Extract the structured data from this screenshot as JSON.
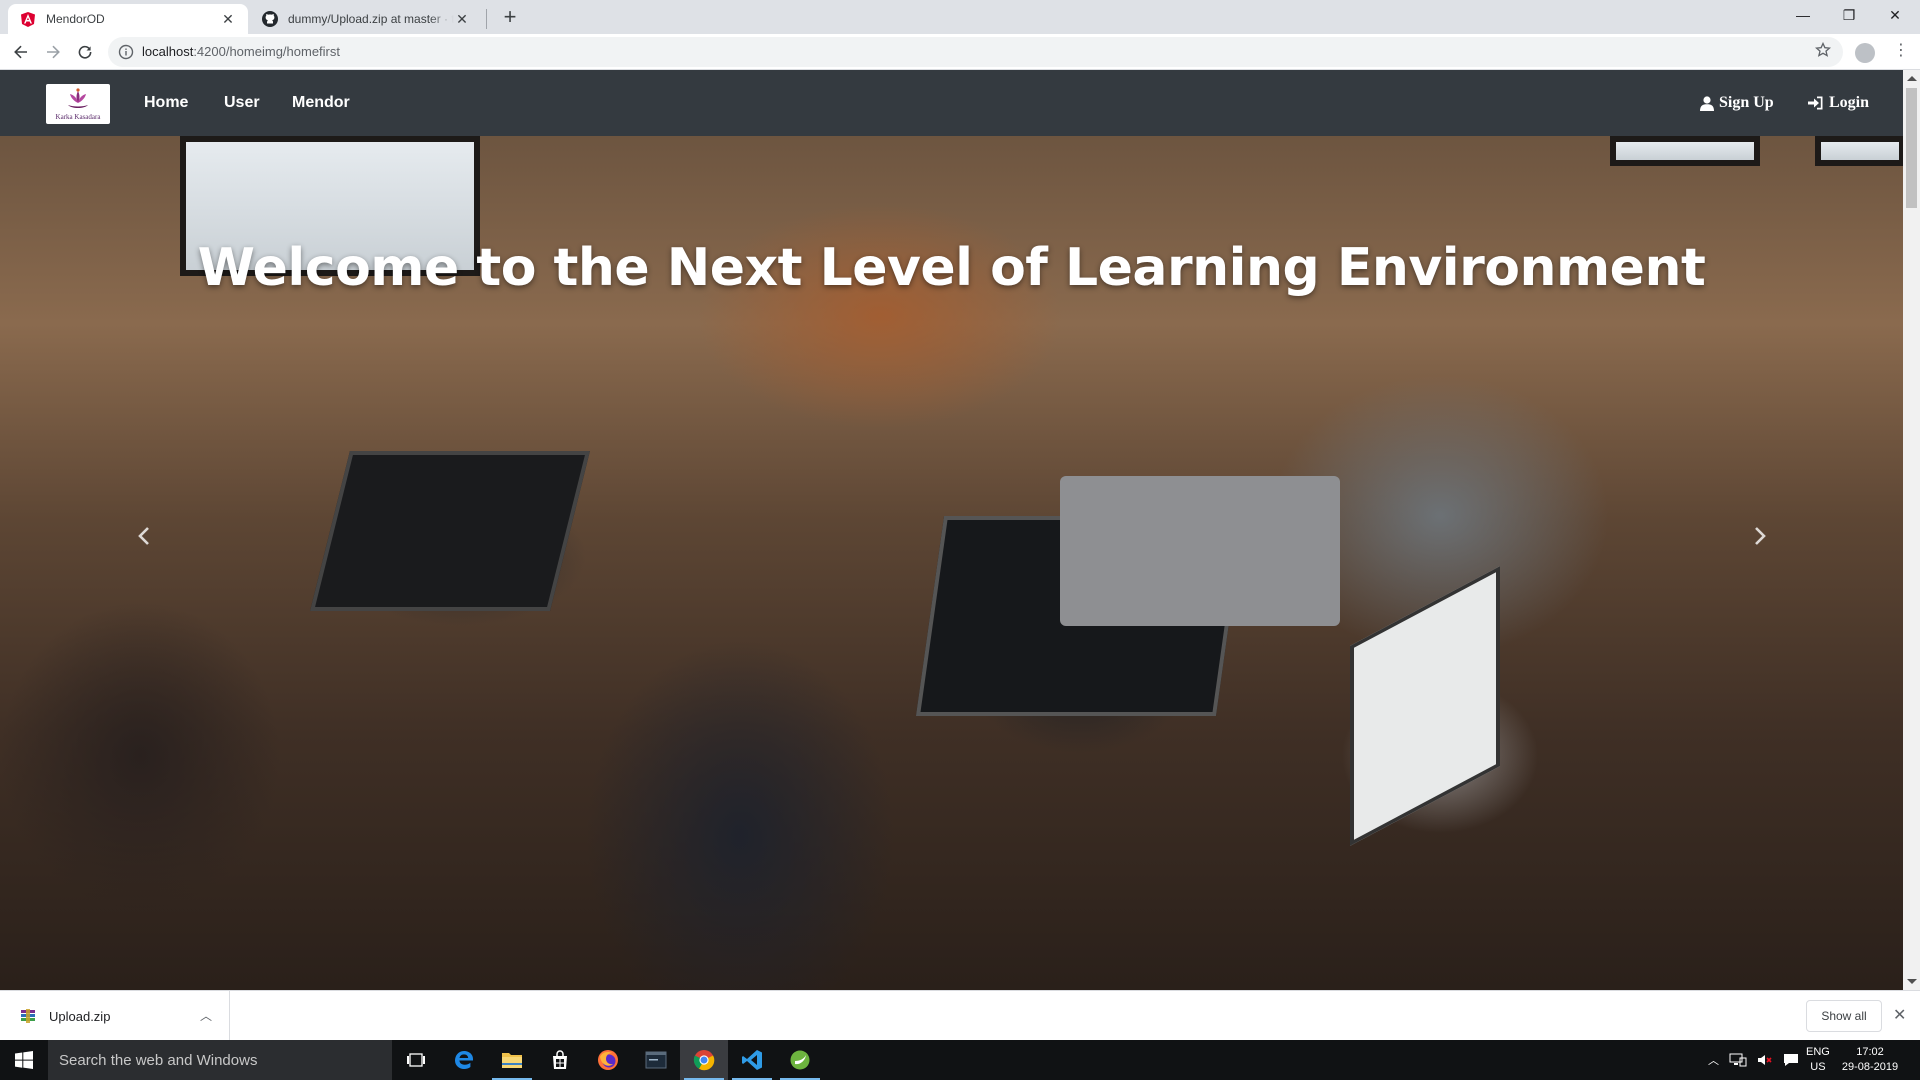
{
  "browser": {
    "tabs": [
      {
        "title": "MendorOD",
        "favicon": "angular-icon"
      },
      {
        "title": "dummy/Upload.zip at master · th",
        "favicon": "github-icon"
      }
    ],
    "new_tab": "+",
    "address": {
      "host": "localhost",
      "path": ":4200/homeimg/homefirst"
    },
    "window_controls": {
      "minimize": "—",
      "maximize": "❐",
      "close": "✕"
    }
  },
  "app": {
    "brand_text": "Karka Kasadara",
    "nav": {
      "home": "Home",
      "user": "User",
      "mendor": "Mendor"
    },
    "auth": {
      "signup": "Sign Up",
      "login": "Login"
    },
    "hero": {
      "headline": "Welcome to the Next Level of Learning Environment"
    }
  },
  "downloads": {
    "file_name": "Upload.zip",
    "show_all": "Show all"
  },
  "taskbar": {
    "search_placeholder": "Search the web and Windows",
    "lang_top": "ENG",
    "lang_bottom": "US",
    "time": "17:02",
    "date": "29-08-2019"
  },
  "colors": {
    "navbar": "#343a40",
    "accent": "#76b9ed"
  }
}
